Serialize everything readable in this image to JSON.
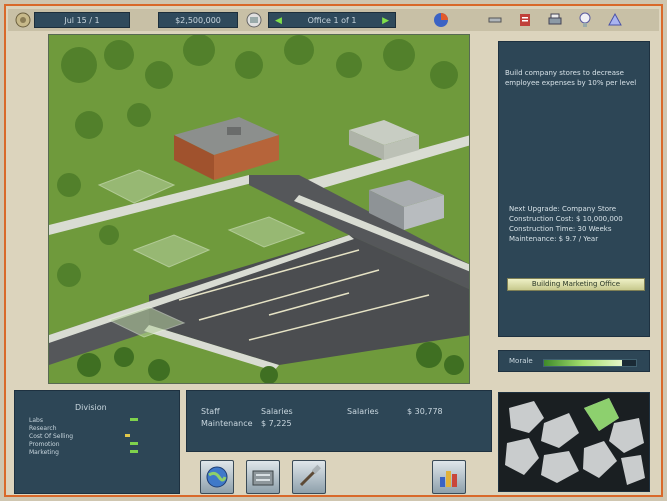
{
  "topbar": {
    "date_text": "Jul 15 / 1",
    "cash": "$2,500,000",
    "office_label": "Office 1 of 1"
  },
  "info_panel": {
    "description": "Build company stores to decrease employee expenses by 10% per level",
    "next_upgrade": "Next Upgrade: Company Store",
    "construction_cost": "Construction Cost: $ 10,000,000",
    "construction_time": "Construction Time: 30 Weeks",
    "maintenance": "Maintenance: $ 9.7 / Year",
    "build_button": "Building Marketing Office"
  },
  "morale": {
    "label": "Morale",
    "level": 0.85
  },
  "departments": {
    "title": "Division",
    "rows": [
      "Labs",
      "Research",
      "Cost Of Selling",
      "Promotion",
      "Marketing"
    ]
  },
  "stats": {
    "staff_label": "Staff",
    "staff_value": "Salaries",
    "maintenance_label": "Maintenance",
    "maintenance_value": "$ 7,225",
    "salaries_label": "Salaries",
    "salaries_value": "$ 30,778"
  },
  "icons": [
    "globe-icon",
    "office-building-icon",
    "tools-icon",
    "bar-chart-icon"
  ],
  "colors": {
    "frame_orange": "#d9692a",
    "panel_blue": "#2d4656",
    "grass": "#6f9a3c",
    "road": "#4a4a4a"
  }
}
